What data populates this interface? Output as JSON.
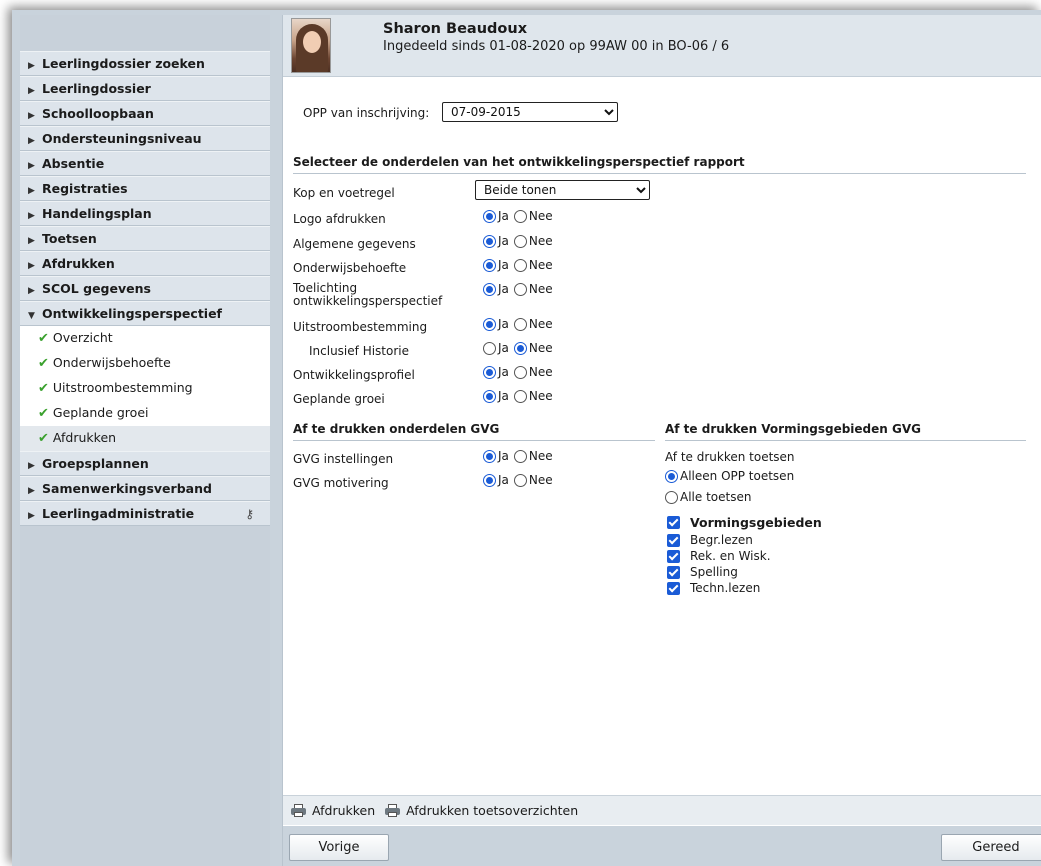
{
  "student": {
    "name": "Sharon Beaudoux",
    "subtitle": "Ingedeeld sinds 01-08-2020 op 99AW 00 in BO-06 / 6"
  },
  "sidebar": {
    "items": [
      {
        "label": "Leerlingdossier zoeken"
      },
      {
        "label": "Leerlingdossier"
      },
      {
        "label": "Schoolloopbaan"
      },
      {
        "label": "Ondersteuningsniveau"
      },
      {
        "label": "Absentie"
      },
      {
        "label": "Registraties"
      },
      {
        "label": "Handelingsplan"
      },
      {
        "label": "Toetsen"
      },
      {
        "label": "Afdrukken"
      },
      {
        "label": "SCOL gegevens"
      },
      {
        "label": "Ontwikkelingsperspectief"
      }
    ],
    "subitems": [
      {
        "label": "Overzicht"
      },
      {
        "label": "Onderwijsbehoefte"
      },
      {
        "label": "Uitstroombestemming"
      },
      {
        "label": "Geplande groei"
      },
      {
        "label": "Afdrukken"
      }
    ],
    "items_after": [
      {
        "label": "Groepsplannen"
      },
      {
        "label": "Samenwerkingsverband"
      },
      {
        "label": "Leerlingadministratie"
      }
    ],
    "arrow_closed": "▶",
    "arrow_open": "▼",
    "check": "✔",
    "key_icon": "⚷"
  },
  "opp": {
    "label": "OPP van inschrijving:",
    "value": "07-09-2015"
  },
  "section1": {
    "title": "Selecteer de onderdelen van het ontwikkelingsperspectief rapport",
    "kop_label": "Kop en voetregel",
    "kop_value": "Beide tonen",
    "yes": "Ja",
    "no": "Nee",
    "rows": [
      {
        "label": "Logo afdrukken",
        "value": "Ja"
      },
      {
        "label": "Algemene gegevens",
        "value": "Ja"
      },
      {
        "label": "Onderwijsbehoefte",
        "value": "Ja"
      },
      {
        "label": "Toelichting ontwikkelingsperspectief",
        "value": "Ja"
      },
      {
        "label": "Uitstroombestemming",
        "value": "Ja"
      },
      {
        "label": "Inclusief Historie",
        "value": "Nee"
      },
      {
        "label": "Ontwikkelingsprofiel",
        "value": "Ja"
      },
      {
        "label": "Geplande groei",
        "value": "Ja"
      }
    ]
  },
  "gvg": {
    "title": "Af te drukken onderdelen GVG",
    "rows": [
      {
        "label": "GVG instellingen",
        "value": "Ja"
      },
      {
        "label": "GVG motivering",
        "value": "Ja"
      }
    ]
  },
  "vorming": {
    "title": "Af te drukken Vormingsgebieden GVG",
    "toetsen_label": "Af te drukken toetsen",
    "option1": "Alleen OPP toetsen",
    "option2": "Alle toetsen",
    "selected": "Alleen OPP toetsen",
    "group_label": "Vormingsgebieden",
    "items": [
      "Begr.lezen",
      "Rek. en Wisk.",
      "Spelling",
      "Techn.lezen"
    ]
  },
  "toolbar": {
    "print_label": "Afdrukken",
    "print_tests_label": "Afdrukken toetsoverzichten"
  },
  "footer": {
    "prev_label": "Vorige",
    "done_label": "Gereed"
  }
}
